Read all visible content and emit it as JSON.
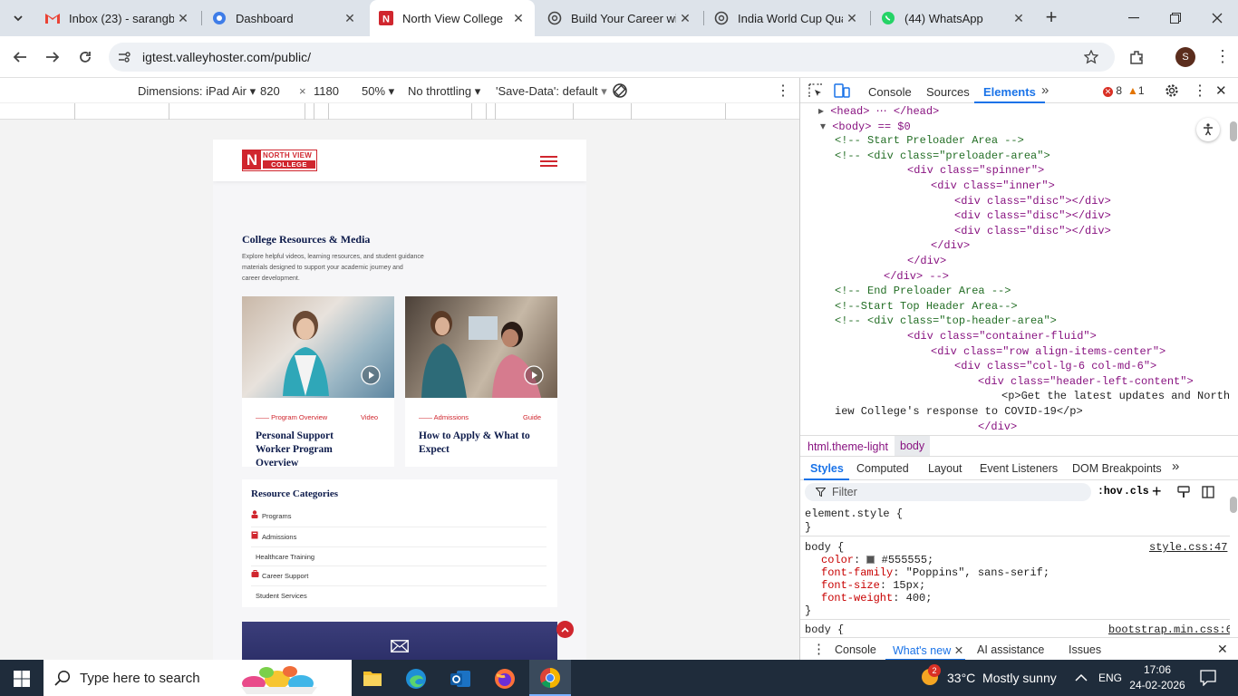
{
  "tabs": [
    {
      "title": "Inbox (23) - sarangba",
      "icon": "gmail-icon"
    },
    {
      "title": "Dashboard",
      "icon": "dashboard-icon"
    },
    {
      "title": "North View College",
      "icon": "nvc-icon"
    },
    {
      "title": "Build Your Career with",
      "icon": "chatgpt-icon"
    },
    {
      "title": "India World Cup Qua",
      "icon": "chatgpt-icon"
    },
    {
      "title": "(44) WhatsApp",
      "icon": "whatsapp-icon"
    }
  ],
  "omnibox": {
    "url": "igtest.valleyhoster.com/public/",
    "profile": "S"
  },
  "device": {
    "dimensions": "Dimensions: iPad Air",
    "width": "820",
    "x": "×",
    "height": "1180",
    "zoom": "50%",
    "throttle": "No throttling",
    "savedata": "'Save-Data': default"
  },
  "site": {
    "logo_top": "NORTH VIEW",
    "logo_bottom": "COLLEGE",
    "logo_letter": "N",
    "section_title": "College Resources & Media",
    "section_desc": [
      "Explore helpful videos, learning resources, and student guidance",
      "materials designed to support your academic journey and",
      "career development."
    ],
    "cards": [
      {
        "tag": "Program Overview",
        "type": "Video",
        "title": [
          "Personal Support",
          "Worker Program",
          "Overview"
        ]
      },
      {
        "tag": "Admissions",
        "type": "Guide",
        "title": [
          "How to Apply & What to",
          "Expect"
        ]
      }
    ],
    "categories_title": "Resource Categories",
    "categories": [
      "Programs",
      "Admissions",
      "Healthcare Training",
      "Career Support",
      "Student Services"
    ]
  },
  "devtools": {
    "tabs": [
      "Console",
      "Sources",
      "Elements"
    ],
    "errors": "8",
    "warnings": "1",
    "dom_lines": [
      "<head> ⋯ </head>",
      "<body> == $0",
      "<!-- Start Preloader Area -->",
      "<!-- <div class=\"preloader-area\">",
      "<div class=\"spinner\">",
      "<div class=\"inner\">",
      "<div class=\"disc\"></div>",
      "<div class=\"disc\"></div>",
      "<div class=\"disc\"></div>",
      "</div>",
      "</div>",
      "</div> -->",
      "<!-- End Preloader Area -->",
      "<!--Start Top Header Area-->",
      "<!-- <div class=\"top-header-area\">",
      "<div class=\"container-fluid\">",
      "<div class=\"row align-items-center\">",
      "<div class=\"col-lg-6 col-md-6\">",
      "<div class=\"header-left-content\">",
      "<p>Get the latest updates and North V",
      "iew College's response to COVID-19</p>",
      "</div>"
    ],
    "crumbs": [
      "html.theme-light",
      "body"
    ],
    "style_tabs": [
      "Styles",
      "Computed",
      "Layout",
      "Event Listeners",
      "DOM Breakpoints"
    ],
    "filter": "Filter",
    "hov": ":hov",
    "cls": ".cls",
    "element_style": "element.style {",
    "close_brace": "}",
    "body_rule": "body {",
    "body_src": "style.css:47",
    "props": [
      {
        "name": "color",
        "value": "#555555;"
      },
      {
        "name": "font-family",
        "value": "\"Poppins\", sans-serif;"
      },
      {
        "name": "font-size",
        "value": "15px;"
      },
      {
        "name": "font-weight",
        "value": "400;"
      }
    ],
    "body_rule2": "body {",
    "body_src2": "bootstrap.min.css:6",
    "drawer": [
      "Console",
      "What's new",
      "AI assistance",
      "Issues"
    ]
  },
  "taskbar": {
    "search": "Type here to search",
    "weather": "33°C  Mostly sunny",
    "lang": "ENG",
    "time": "17:06",
    "date": "24-02-2026",
    "weather_badge": "2"
  },
  "colors": {
    "brand": "#d0262e",
    "navy": "#0d1b4b",
    "chrome": "#dde3ea",
    "devtools_blue": "#1a73e8"
  }
}
